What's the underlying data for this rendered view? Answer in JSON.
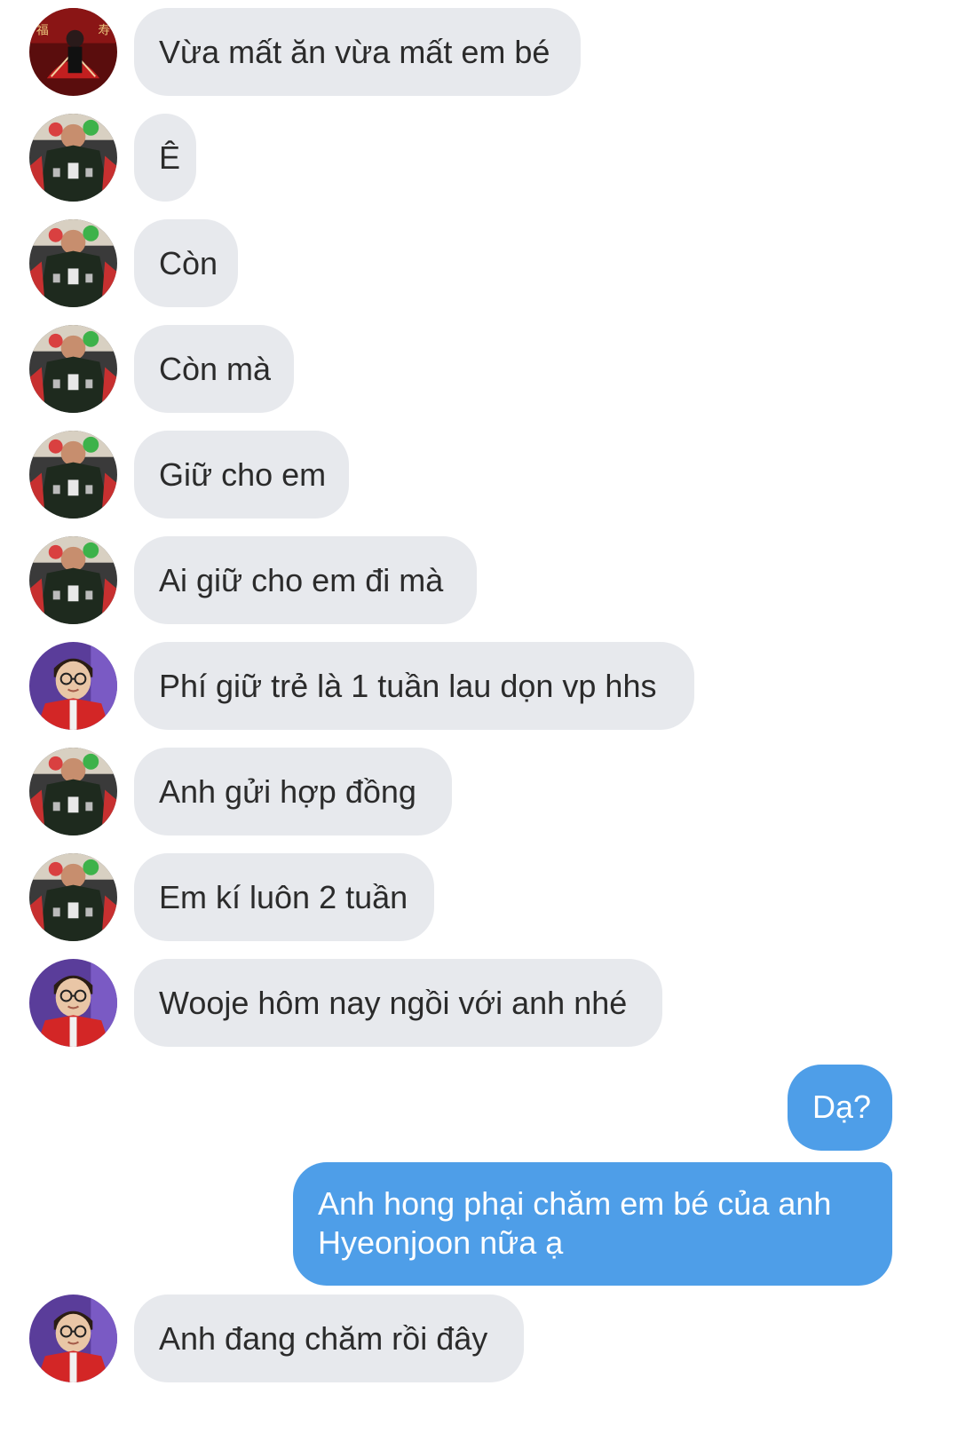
{
  "colors": {
    "incoming_bubble": "#e7e9ed",
    "outgoing_bubble": "#4e9ee8",
    "incoming_text": "#2b2b2b",
    "outgoing_text": "#ffffff"
  },
  "messages": [
    {
      "direction": "incoming",
      "avatar": "red-fan-avatar",
      "text": "Vừa mất ăn vừa mất em bé"
    },
    {
      "direction": "incoming",
      "avatar": "jacket-avatar",
      "text": "Ê"
    },
    {
      "direction": "incoming",
      "avatar": "jacket-avatar",
      "text": "Còn"
    },
    {
      "direction": "incoming",
      "avatar": "jacket-avatar",
      "text": "Còn mà"
    },
    {
      "direction": "incoming",
      "avatar": "jacket-avatar",
      "text": "Giữ cho em"
    },
    {
      "direction": "incoming",
      "avatar": "jacket-avatar",
      "text": "Ai giữ cho em đi mà"
    },
    {
      "direction": "incoming",
      "avatar": "glasses-avatar",
      "text": "Phí giữ trẻ là 1 tuần lau dọn vp hhs"
    },
    {
      "direction": "incoming",
      "avatar": "jacket-avatar",
      "text": "Anh gửi hợp đồng"
    },
    {
      "direction": "incoming",
      "avatar": "jacket-avatar",
      "text": "Em kí luôn 2 tuần"
    },
    {
      "direction": "incoming",
      "avatar": "glasses-avatar",
      "text": "Wooje hôm nay ngồi với anh nhé"
    },
    {
      "direction": "outgoing",
      "text": "Dạ?"
    },
    {
      "direction": "outgoing",
      "text_lines": [
        "Anh hong phại chăm em bé của anh",
        "Hyeonjoon nữa ạ"
      ]
    },
    {
      "direction": "incoming",
      "avatar": "glasses-avatar",
      "text": "Anh đang chăm rồi đây"
    }
  ]
}
